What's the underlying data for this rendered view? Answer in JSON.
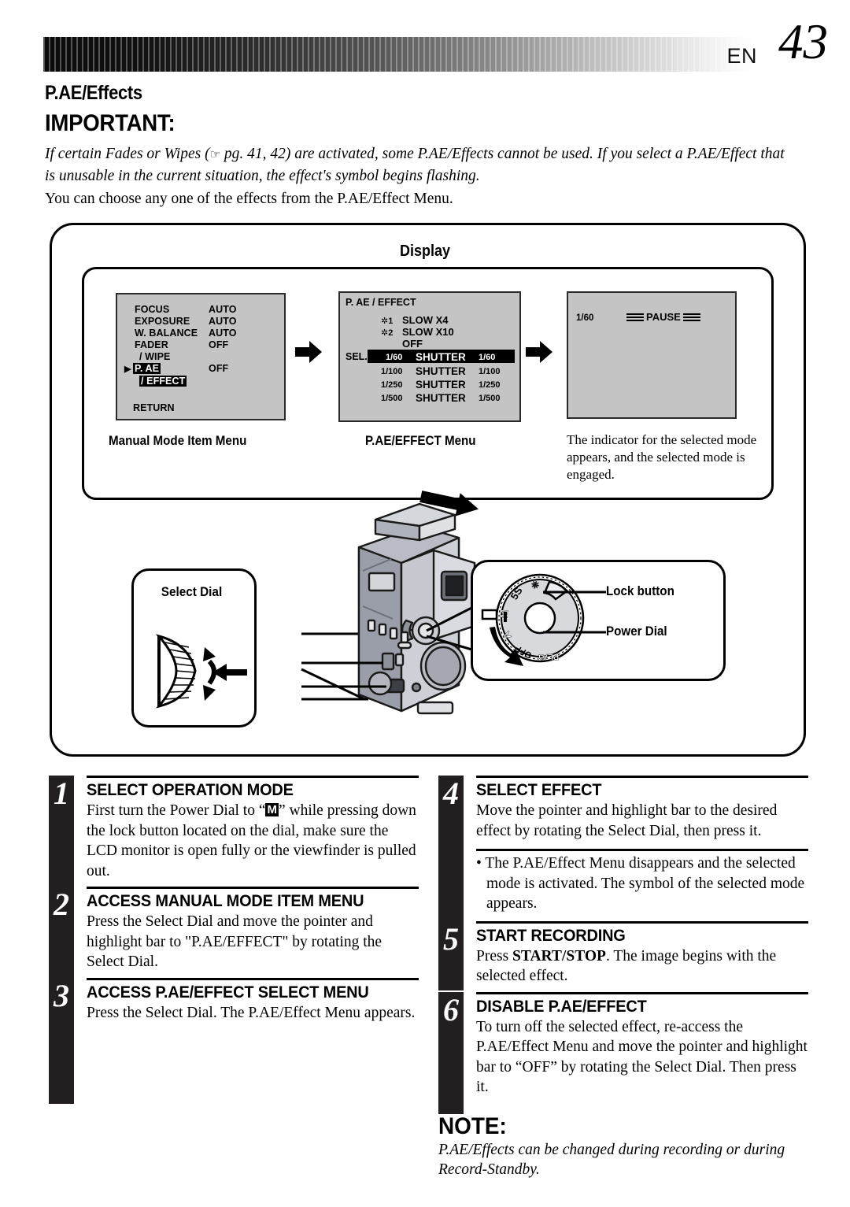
{
  "header": {
    "en_label": "EN",
    "page_number": "43"
  },
  "section": {
    "title": "P.AE/Effects",
    "important_heading": "IMPORTANT:",
    "important_body_line1": "If certain Fades or Wipes (",
    "important_pg": " pg. 41, 42) are activated, some P.AE/Effects cannot be used. If you select a",
    "important_body_line2": "P.AE/Effect that is unusable in the current situation, the effect's symbol begins flashing.",
    "intro": "You can choose any one of the effects from the P.AE/Effect Menu."
  },
  "display_panel": {
    "label": "Display",
    "caption_manual": "Manual Mode Item Menu",
    "caption_paemenu": "P.AE/EFFECT Menu",
    "caption_result": "The indicator for the selected mode appears, and the selected mode is engaged."
  },
  "manual_menu": {
    "rows": [
      {
        "label": "FOCUS",
        "value": "AUTO"
      },
      {
        "label": "EXPOSURE",
        "value": "AUTO"
      },
      {
        "label": "W. BALANCE",
        "value": "AUTO"
      },
      {
        "label": "FADER",
        "value": "OFF"
      },
      {
        "label": "/ WIPE",
        "value": ""
      },
      {
        "label": "P. AE",
        "value": "OFF"
      },
      {
        "label": "/ EFFECT",
        "value": ""
      }
    ],
    "return_label": "RETURN",
    "pointer": "▶"
  },
  "pae_menu": {
    "title": "P. AE / EFFECT",
    "sel_label": "SEL.",
    "pointer": "▶",
    "items": [
      {
        "sym": "☀",
        "symnum": "1",
        "speed": "",
        "name": "SLOW X4",
        "value": "",
        "selected": false
      },
      {
        "sym": "☀",
        "symnum": "2",
        "speed": "",
        "name": "SLOW X10",
        "value": "",
        "selected": false
      },
      {
        "sym": "",
        "symnum": "",
        "speed": "",
        "name": "OFF",
        "value": "",
        "selected": false
      },
      {
        "sym": "",
        "symnum": "",
        "speed": "1/60",
        "name": "SHUTTER",
        "value": "1/60",
        "selected": true
      },
      {
        "sym": "",
        "symnum": "",
        "speed": "1/100",
        "name": "SHUTTER",
        "value": "1/100",
        "selected": false
      },
      {
        "sym": "",
        "symnum": "",
        "speed": "1/250",
        "name": "SHUTTER",
        "value": "1/250",
        "selected": false
      },
      {
        "sym": "",
        "symnum": "",
        "speed": "1/500",
        "name": "SHUTTER",
        "value": "1/500",
        "selected": false
      }
    ]
  },
  "result_screen": {
    "shutter_speed": "1/60",
    "status": "PAUSE"
  },
  "callouts": {
    "select_dial": "Select Dial",
    "lock_button": "Lock button",
    "power_dial": "Power Dial",
    "dial_positions": [
      "⏻",
      "5S",
      "M",
      "A",
      "OFF",
      "PLAY"
    ]
  },
  "steps": [
    {
      "number": "1",
      "heading": "SELECT OPERATION MODE",
      "body_pre": "First turn the Power Dial to “",
      "body_icon": "M",
      "body_post": "” while pressing down the lock button located on the dial, make sure the LCD monitor is open fully or the viewfinder is pulled out."
    },
    {
      "number": "2",
      "heading": "ACCESS MANUAL MODE ITEM MENU",
      "body": "Press the Select Dial and move the pointer and highlight bar to \"P.AE/EFFECT\" by rotating the Select Dial."
    },
    {
      "number": "3",
      "heading": "ACCESS P.AE/EFFECT SELECT MENU",
      "body": "Press the Select Dial. The P.AE/Effect Menu appears."
    },
    {
      "number": "4",
      "heading": "SELECT EFFECT",
      "body": "Move the pointer and highlight bar to the desired effect by rotating the Select Dial, then press it.",
      "bullet": "• The P.AE/Effect Menu disappears and the selected mode is activated. The symbol of the selected mode appears."
    },
    {
      "number": "5",
      "heading": "START RECORDING",
      "body_pre": "Press ",
      "body_bold": "START/STOP",
      "body_post": ". The image begins with the selected effect."
    },
    {
      "number": "6",
      "heading": "DISABLE P.AE/EFFECT",
      "body": "To turn off the selected effect, re-access the P.AE/Effect Menu and move the pointer and highlight bar to “OFF” by rotating the Select Dial. Then press it."
    }
  ],
  "note": {
    "heading": "NOTE:",
    "body": "P.AE/Effects can be changed during recording or during Record-Standby."
  }
}
